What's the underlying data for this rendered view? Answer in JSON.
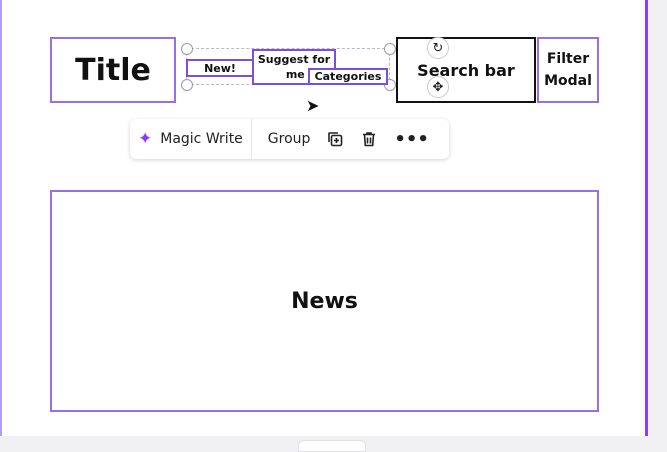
{
  "canvas": {
    "title_label": "Title",
    "search_label": "Search bar",
    "filter_label_line1": "Filter",
    "filter_label_line2": "Modal",
    "news_label": "News",
    "new_label": "New!",
    "suggest_label_line1": "Suggest for",
    "suggest_label_line2": "me",
    "categories_label": "Categories"
  },
  "toolbar": {
    "magic_write_label": "Magic Write",
    "group_label": "Group",
    "icons": [
      "sparkle-icon",
      "duplicate-icon",
      "trash-icon",
      "more-icon"
    ]
  },
  "controls": {
    "rotate_icon": "rotate-icon",
    "move_icon": "move-icon"
  },
  "colors": {
    "accent": "#8b3dff",
    "element_border": "#9b6fe3",
    "text": "#111111"
  }
}
